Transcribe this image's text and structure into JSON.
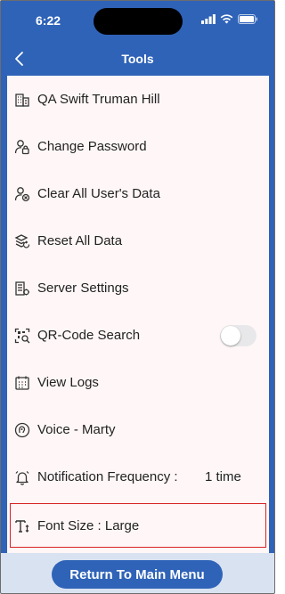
{
  "status": {
    "time": "6:22"
  },
  "header": {
    "title": "Tools",
    "back_icon": "chevron-left-icon"
  },
  "rows": [
    {
      "label": "QA Swift Truman Hill",
      "icon": "building-icon"
    },
    {
      "label": "Change Password",
      "icon": "user-lock-icon"
    },
    {
      "label": "Clear All User's Data",
      "icon": "user-clear-icon"
    },
    {
      "label": "Reset All Data",
      "icon": "reset-data-icon"
    },
    {
      "label": "Server Settings",
      "icon": "server-icon"
    },
    {
      "label": "QR-Code Search",
      "icon": "qr-search-icon",
      "toggle_on": false
    },
    {
      "label": "View Logs",
      "icon": "calendar-log-icon"
    },
    {
      "label": "Voice - Marty",
      "icon": "voice-icon"
    },
    {
      "label": "Notification Frequency :",
      "value": "1 time",
      "icon": "bell-icon"
    },
    {
      "label": "Font Size :  Large",
      "icon": "font-size-icon"
    }
  ],
  "footer": {
    "main_menu_label": "Return To Main Menu"
  },
  "colors": {
    "accent": "#2f63b8",
    "highlight": "#d62222",
    "content_bg": "#fff7f7"
  }
}
